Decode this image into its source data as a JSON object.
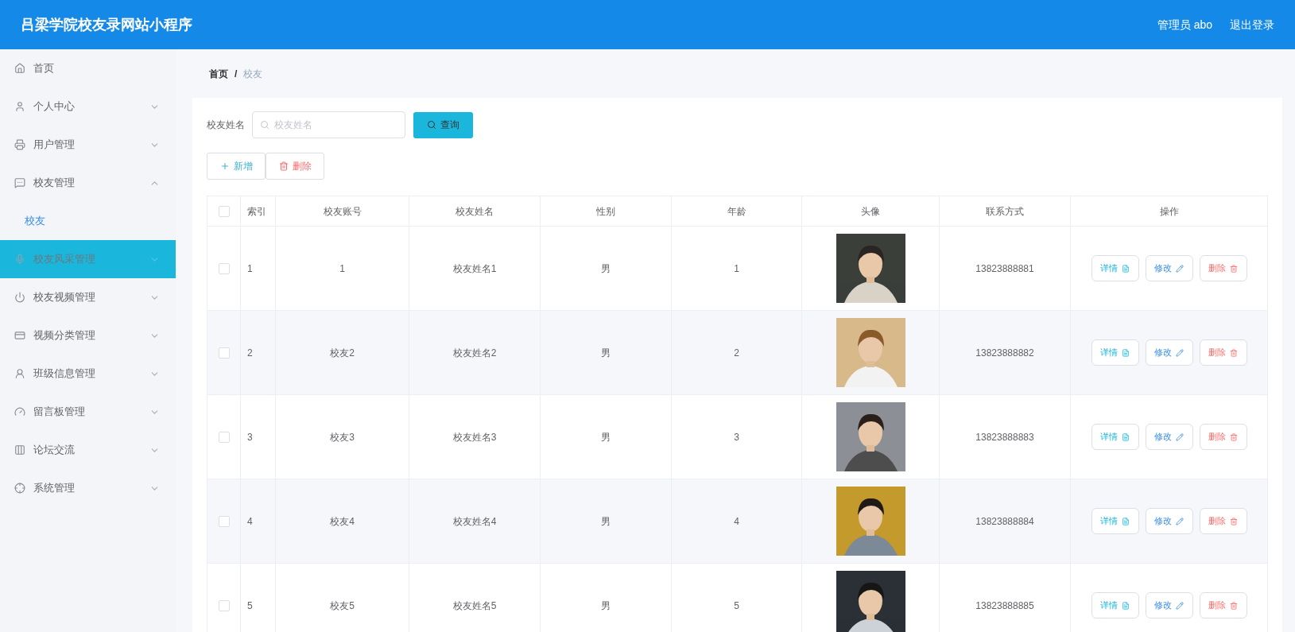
{
  "header": {
    "title": "吕梁学院校友录网站小程序",
    "user": "管理员 abo",
    "logout": "退出登录"
  },
  "sidebar": {
    "items": [
      {
        "label": "首页",
        "kind": "link",
        "highlighted": false
      },
      {
        "label": "个人中心",
        "kind": "menu",
        "expanded": false,
        "highlighted": false
      },
      {
        "label": "用户管理",
        "kind": "menu",
        "expanded": false,
        "highlighted": false
      },
      {
        "label": "校友管理",
        "kind": "menu",
        "expanded": true,
        "highlighted": false,
        "children": [
          {
            "label": "校友",
            "selected": true
          }
        ]
      },
      {
        "label": "校友风采管理",
        "kind": "menu",
        "expanded": false,
        "highlighted": true
      },
      {
        "label": "校友视频管理",
        "kind": "menu",
        "expanded": false,
        "highlighted": false
      },
      {
        "label": "视频分类管理",
        "kind": "menu",
        "expanded": false,
        "highlighted": false
      },
      {
        "label": "班级信息管理",
        "kind": "menu",
        "expanded": false,
        "highlighted": false
      },
      {
        "label": "留言板管理",
        "kind": "menu",
        "expanded": false,
        "highlighted": false
      },
      {
        "label": "论坛交流",
        "kind": "menu",
        "expanded": false,
        "highlighted": false
      },
      {
        "label": "系统管理",
        "kind": "menu",
        "expanded": false,
        "highlighted": false
      }
    ]
  },
  "breadcrumb": [
    "首页",
    "/",
    "校友"
  ],
  "search": {
    "label": "校友姓名",
    "placeholder": "校友姓名",
    "button": "查询"
  },
  "toolbar": [
    {
      "label": "新增",
      "kind": "add"
    },
    {
      "label": "删除",
      "kind": "delete"
    }
  ],
  "table": {
    "header_checked": false,
    "columns": [
      "索引",
      "校友账号",
      "校友姓名",
      "性别",
      "年龄",
      "头像",
      "联系方式",
      "操作"
    ],
    "rows": [
      {
        "checked": false,
        "index": "1",
        "account": "1",
        "name": "校友姓名1",
        "gender": "男",
        "age": "1",
        "phone": "13823888881",
        "actions": [
          {
            "label": "详情",
            "kind": "detail"
          },
          {
            "label": "修改",
            "kind": "edit"
          },
          {
            "label": "删除",
            "kind": "delete"
          }
        ]
      },
      {
        "checked": false,
        "index": "2",
        "account": "校友2",
        "name": "校友姓名2",
        "gender": "男",
        "age": "2",
        "phone": "13823888882",
        "actions": [
          {
            "label": "详情",
            "kind": "detail"
          },
          {
            "label": "修改",
            "kind": "edit"
          },
          {
            "label": "删除",
            "kind": "delete"
          }
        ]
      },
      {
        "checked": false,
        "index": "3",
        "account": "校友3",
        "name": "校友姓名3",
        "gender": "男",
        "age": "3",
        "phone": "13823888883",
        "actions": [
          {
            "label": "详情",
            "kind": "detail"
          },
          {
            "label": "修改",
            "kind": "edit"
          },
          {
            "label": "删除",
            "kind": "delete"
          }
        ]
      },
      {
        "checked": false,
        "index": "4",
        "account": "校友4",
        "name": "校友姓名4",
        "gender": "男",
        "age": "4",
        "phone": "13823888884",
        "actions": [
          {
            "label": "详情",
            "kind": "detail"
          },
          {
            "label": "修改",
            "kind": "edit"
          },
          {
            "label": "删除",
            "kind": "delete"
          }
        ]
      },
      {
        "checked": false,
        "index": "5",
        "account": "校友5",
        "name": "校友姓名5",
        "gender": "男",
        "age": "5",
        "phone": "13823888885",
        "actions": [
          {
            "label": "详情",
            "kind": "detail"
          },
          {
            "label": "修改",
            "kind": "edit"
          },
          {
            "label": "删除",
            "kind": "delete"
          }
        ]
      }
    ]
  }
}
